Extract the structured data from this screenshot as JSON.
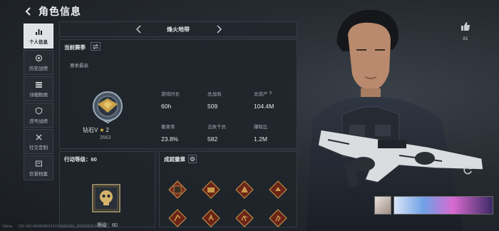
{
  "header": {
    "title": "角色信息"
  },
  "nav": {
    "items": [
      {
        "label": "个人信息",
        "icon": "bar-chart-icon",
        "active": true
      },
      {
        "label": "历史战绩",
        "icon": "record-icon"
      },
      {
        "label": "详细数据",
        "icon": "stack-icon"
      },
      {
        "label": "违号战绩",
        "icon": "shield-icon"
      },
      {
        "label": "社交定制",
        "icon": "tools-icon"
      },
      {
        "label": "信誉档案",
        "icon": "archive-icon"
      }
    ]
  },
  "season_bar": {
    "name": "烽火地带"
  },
  "current_season": {
    "title": "当前赛季",
    "season_best_label": "赛季最高",
    "rank_name": "钻石V",
    "rank_stars": "2",
    "rank_score": "3563",
    "stats": [
      {
        "label": "游戏时长",
        "value": "60h"
      },
      {
        "label": "总战局",
        "value": "509"
      },
      {
        "label": "总资产",
        "value": "104.4M",
        "help": "?"
      },
      {
        "label": "撤离率",
        "value": "23.8%"
      },
      {
        "label": "击败干员",
        "value": "582"
      },
      {
        "label": "赚取比",
        "value": "1.2M"
      }
    ]
  },
  "action_level": {
    "title": "行动等级：60",
    "footer": "等级：60"
  },
  "achievements": {
    "title": "成就徽章"
  },
  "like": {
    "count": "81"
  },
  "footer": {
    "ping": "54ms",
    "cn_uid": "CN UID:4538096241031606183_202505251450"
  },
  "colors": {
    "accent": "#dfe3e6",
    "badge_red": "#8a2b1c",
    "badge_gold": "#c99a4a"
  }
}
